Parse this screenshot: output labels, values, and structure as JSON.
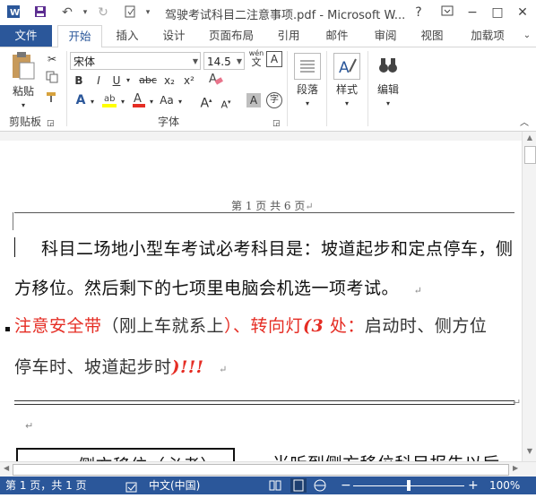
{
  "titlebar": {
    "app_icon": "word-icon",
    "title": "驾驶考试科目二注意事项.pdf - Microsoft W...",
    "help": "?"
  },
  "tabs": [
    "文件",
    "开始",
    "插入",
    "设计",
    "页面布局",
    "引用",
    "邮件",
    "审阅",
    "视图",
    "加载项"
  ],
  "ribbon": {
    "clipboard": {
      "paste_label": "粘贴",
      "group_label": "剪贴板"
    },
    "font": {
      "font_name": "宋体",
      "font_size": "14.5",
      "wen_top": "wén",
      "wen_char": "文",
      "bold": "B",
      "italic": "I",
      "underline": "U",
      "strike": "abc",
      "subscript": "x₂",
      "superscript": "x²",
      "font_color_a": "A",
      "case": "Aa",
      "grow": "A",
      "shrink": "A",
      "char_shade": "A",
      "enclose": "字",
      "group_label": "字体"
    },
    "paragraph_label": "段落",
    "styles_label": "样式",
    "editing_label": "编辑"
  },
  "document": {
    "header_text": "第 1 页 共 6 页",
    "para1_line1": "科目二场地小型车考试必考科目是：坡道起步和定点停车，侧",
    "para1_line2": "方移位。然后剩下的七项里电脑会机选一项考试。",
    "para2_line1_red1": "注意安全带",
    "para2_line1_black1": "（刚上车就系上",
    "para2_line1_red2": "）、转向灯",
    "para2_line1_bold": "(3",
    "para2_line1_red3": "处：",
    "para2_line1_black2": "启动时、侧方位",
    "para2_line2_black": "停车时、坡道起步时",
    "para2_line2_bold": ")!!!",
    "box_text": "一、侧方移位（必考）",
    "after_box_text": "当听到侧方移位科目报告以后"
  },
  "status": {
    "page": "第 1 页，共 1 页",
    "lang": "中文(中国)",
    "zoom": "100%"
  },
  "colors": {
    "accent": "#2b579a",
    "red_text": "#e52d24"
  }
}
